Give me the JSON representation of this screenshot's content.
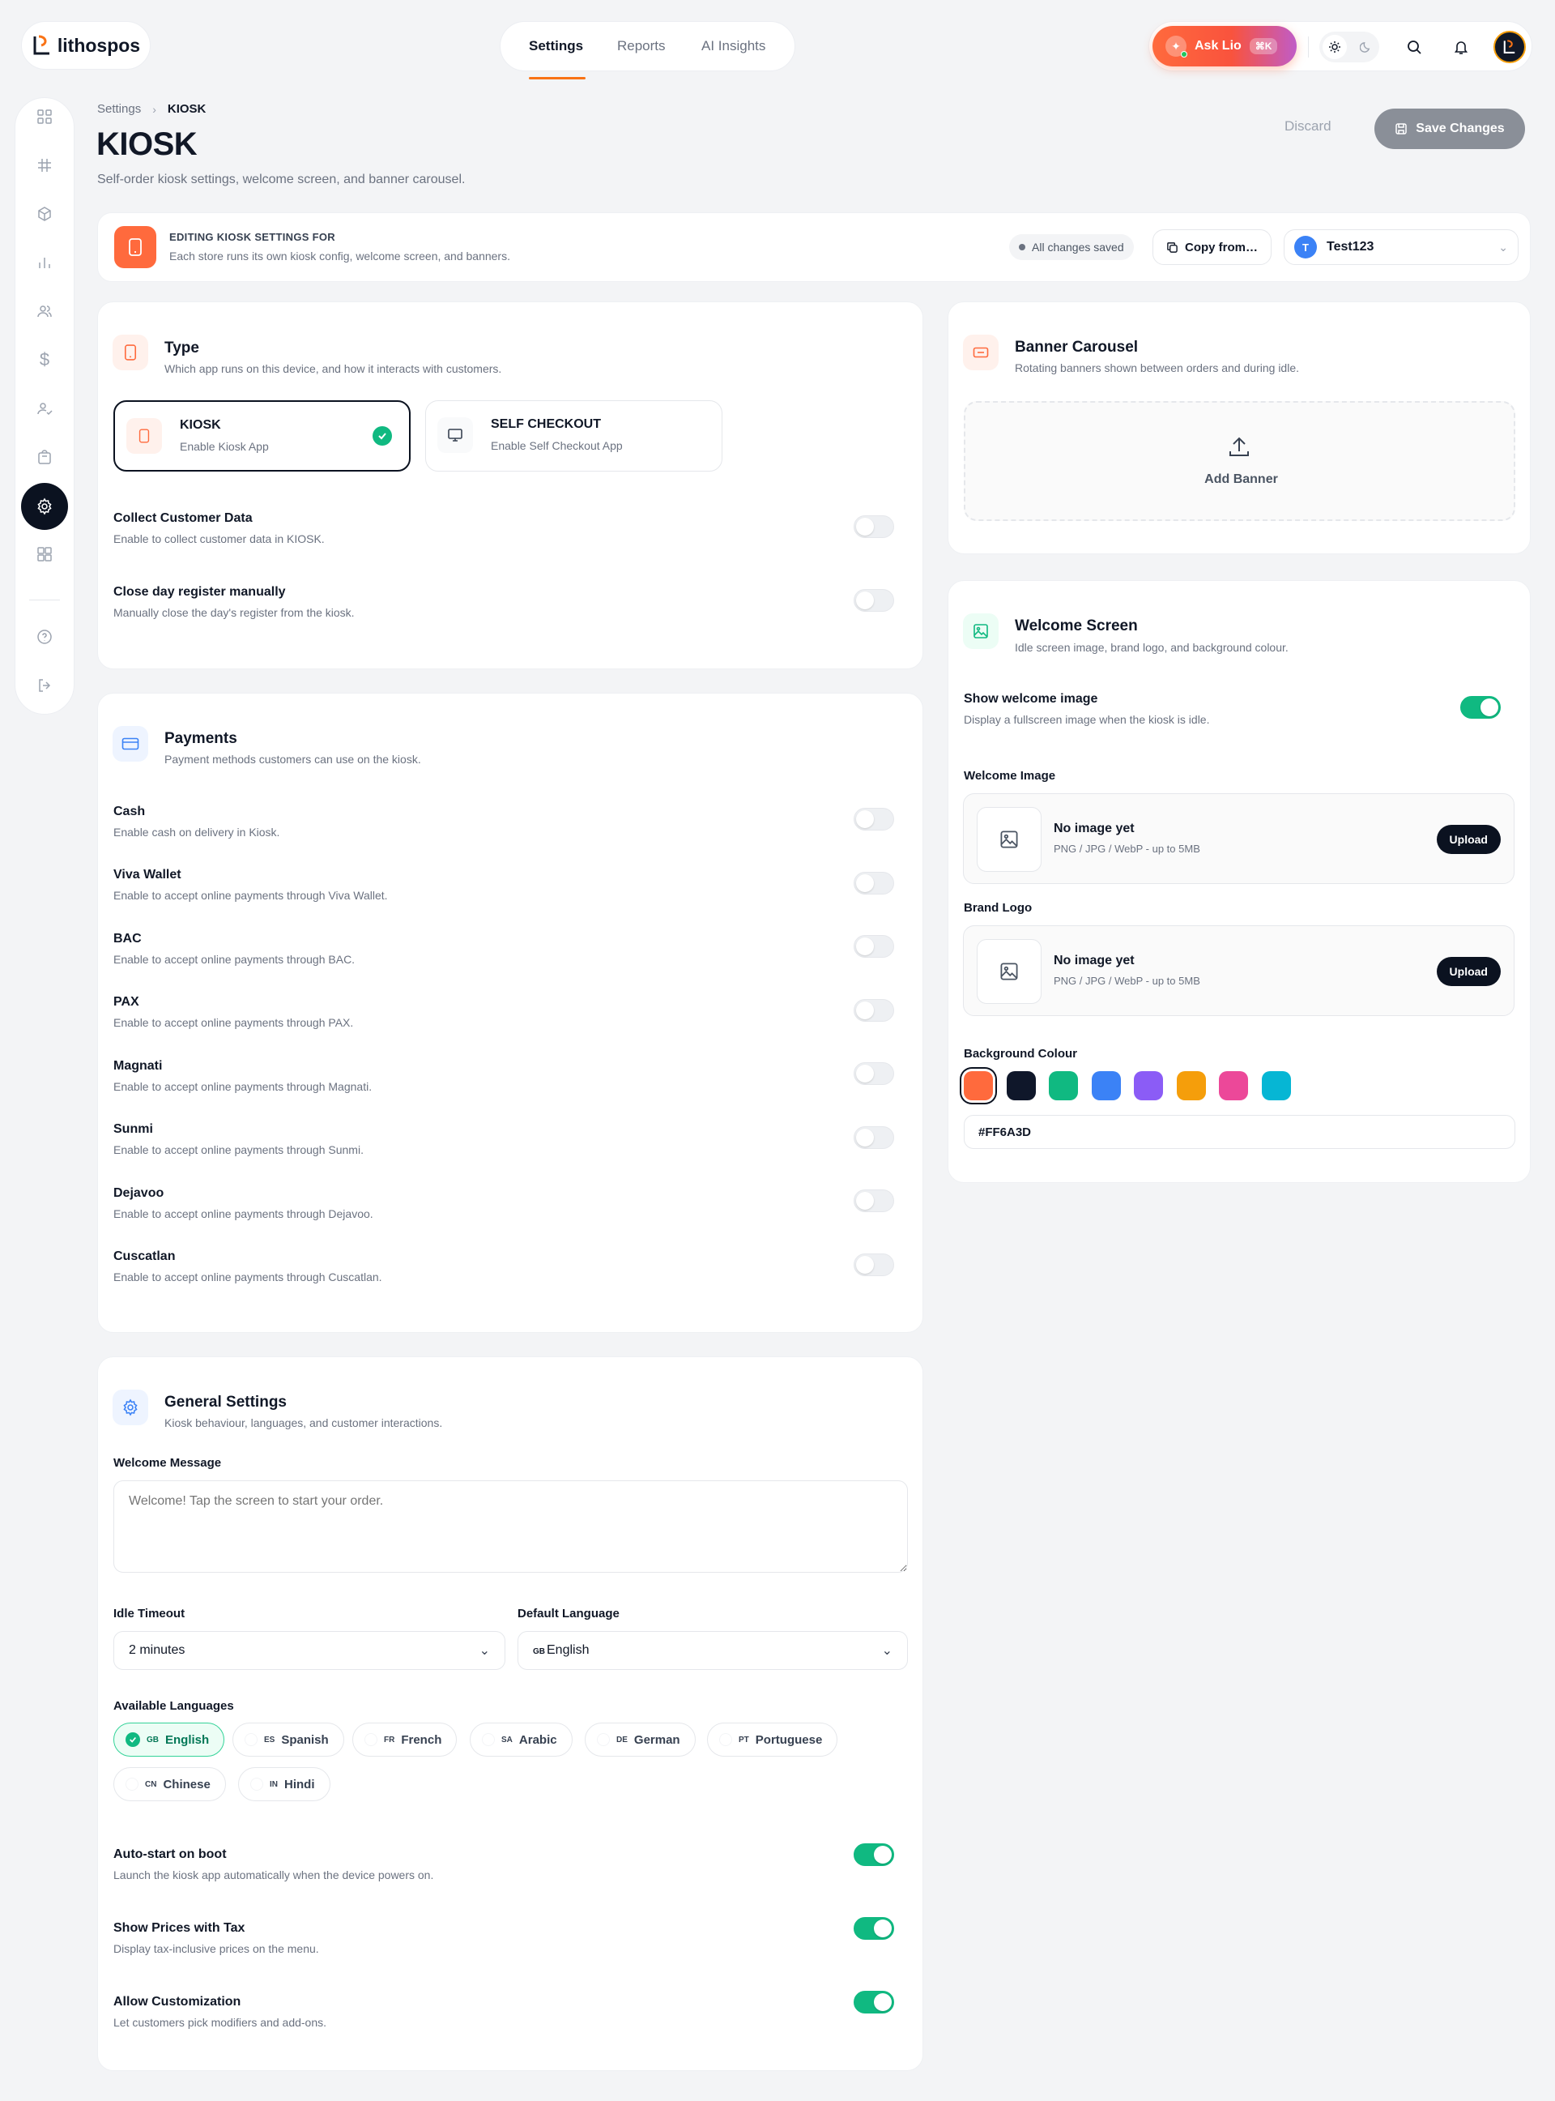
{
  "brand": {
    "name": "lithospos"
  },
  "nav": {
    "tabs": [
      "Settings",
      "Reports",
      "AI Insights"
    ],
    "active": 0
  },
  "ask": {
    "label": "Ask Lio",
    "shortcut": "⌘K"
  },
  "breadcrumb": {
    "parent": "Settings",
    "current": "KIOSK"
  },
  "page": {
    "title": "KIOSK",
    "subtitle": "Self-order kiosk settings, welcome screen, and banner carousel.",
    "discard": "Discard",
    "save": "Save Changes"
  },
  "editing": {
    "label": "EDITING KIOSK SETTINGS FOR",
    "desc": "Each store runs its own kiosk config, welcome screen, and banners.",
    "saved": "All changes saved",
    "copy": "Copy from…",
    "store_initial": "T",
    "store": "Test123"
  },
  "type": {
    "title": "Type",
    "subtitle": "Which app runs on this device, and how it interacts with customers.",
    "options": [
      {
        "title": "KIOSK",
        "desc": "Enable Kiosk App",
        "selected": true
      },
      {
        "title": "SELF CHECKOUT",
        "desc": "Enable Self Checkout App",
        "selected": false
      }
    ],
    "rows": [
      {
        "title": "Collect Customer Data",
        "desc": "Enable to collect customer data in KIOSK.",
        "on": false
      },
      {
        "title": "Close day register manually",
        "desc": "Manually close the day's register from the kiosk.",
        "on": false
      }
    ]
  },
  "payments": {
    "title": "Payments",
    "subtitle": "Payment methods customers can use on the kiosk.",
    "rows": [
      {
        "title": "Cash",
        "desc": "Enable cash on delivery in Kiosk.",
        "on": false
      },
      {
        "title": "Viva Wallet",
        "desc": "Enable to accept online payments through Viva Wallet.",
        "on": false
      },
      {
        "title": "BAC",
        "desc": "Enable to accept online payments through BAC.",
        "on": false
      },
      {
        "title": "PAX",
        "desc": "Enable to accept online payments through PAX.",
        "on": false
      },
      {
        "title": "Magnati",
        "desc": "Enable to accept online payments through Magnati.",
        "on": false
      },
      {
        "title": "Sunmi",
        "desc": "Enable to accept online payments through Sunmi.",
        "on": false
      },
      {
        "title": "Dejavoo",
        "desc": "Enable to accept online payments through Dejavoo.",
        "on": false
      },
      {
        "title": "Cuscatlan",
        "desc": "Enable to accept online payments through Cuscatlan.",
        "on": false
      }
    ]
  },
  "general": {
    "title": "General Settings",
    "subtitle": "Kiosk behaviour, languages, and customer interactions.",
    "welcome_label": "Welcome Message",
    "welcome_placeholder": "Welcome! Tap the screen to start your order.",
    "idle_label": "Idle Timeout",
    "idle_value": "2 minutes",
    "lang_label": "Default Language",
    "lang_code": "GB",
    "lang_value": "English",
    "available_label": "Available Languages",
    "languages": [
      {
        "code": "GB",
        "name": "English",
        "selected": true
      },
      {
        "code": "ES",
        "name": "Spanish",
        "selected": false
      },
      {
        "code": "FR",
        "name": "French",
        "selected": false
      },
      {
        "code": "SA",
        "name": "Arabic",
        "selected": false
      },
      {
        "code": "DE",
        "name": "German",
        "selected": false
      },
      {
        "code": "PT",
        "name": "Portuguese",
        "selected": false
      },
      {
        "code": "CN",
        "name": "Chinese",
        "selected": false
      },
      {
        "code": "IN",
        "name": "Hindi",
        "selected": false
      }
    ],
    "rows": [
      {
        "title": "Auto-start on boot",
        "desc": "Launch the kiosk app automatically when the device powers on.",
        "on": true
      },
      {
        "title": "Show Prices with Tax",
        "desc": "Display tax-inclusive prices on the menu.",
        "on": true
      },
      {
        "title": "Allow Customization",
        "desc": "Let customers pick modifiers and add-ons.",
        "on": true
      }
    ]
  },
  "banner": {
    "title": "Banner Carousel",
    "subtitle": "Rotating banners shown between orders and during idle.",
    "add": "Add Banner"
  },
  "welcome": {
    "title": "Welcome Screen",
    "subtitle": "Idle screen image, brand logo, and background colour.",
    "show_title": "Show welcome image",
    "show_desc": "Display a fullscreen image when the kiosk is idle.",
    "show_on": true,
    "image_label": "Welcome Image",
    "logo_label": "Brand Logo",
    "no_image": "No image yet",
    "formats": "PNG / JPG / WebP - up to 5MB",
    "upload": "Upload",
    "bg_label": "Background Colour",
    "swatches": [
      "#FF6A3D",
      "#0F172A",
      "#10B981",
      "#3B82F6",
      "#8B5CF6",
      "#F59E0B",
      "#EC4899",
      "#06B6D4"
    ],
    "bg_value": "#FF6A3D"
  },
  "colors": {
    "accent": "#FF6A3D",
    "success": "#10B981",
    "dark": "#0B1220"
  }
}
